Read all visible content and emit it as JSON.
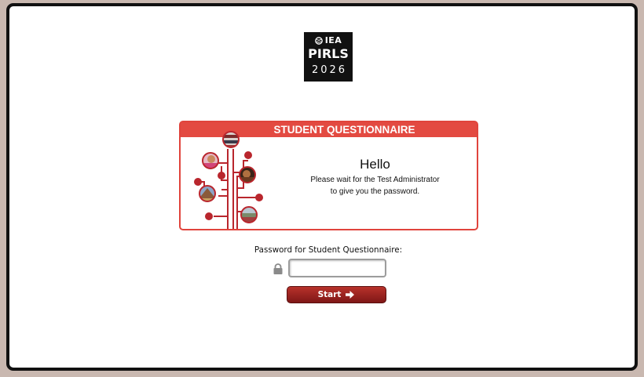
{
  "logo": {
    "org": "IEA",
    "name": "PIRLS",
    "year": "2026",
    "icon": "iea-globe-icon"
  },
  "card": {
    "header": "STUDENT QUESTIONNAIRE",
    "greeting": "Hello",
    "message": "Please wait for the Test Administrator to give you the password.",
    "illustration": "tree-of-photo-circles",
    "accent_color": "#e34a41"
  },
  "login": {
    "password_label": "Password for Student Questionnaire:",
    "password_value": "",
    "lock_icon": "lock-icon",
    "start_label": "Start",
    "start_icon": "arrow-right-icon",
    "button_color": "#8e1d1a"
  }
}
